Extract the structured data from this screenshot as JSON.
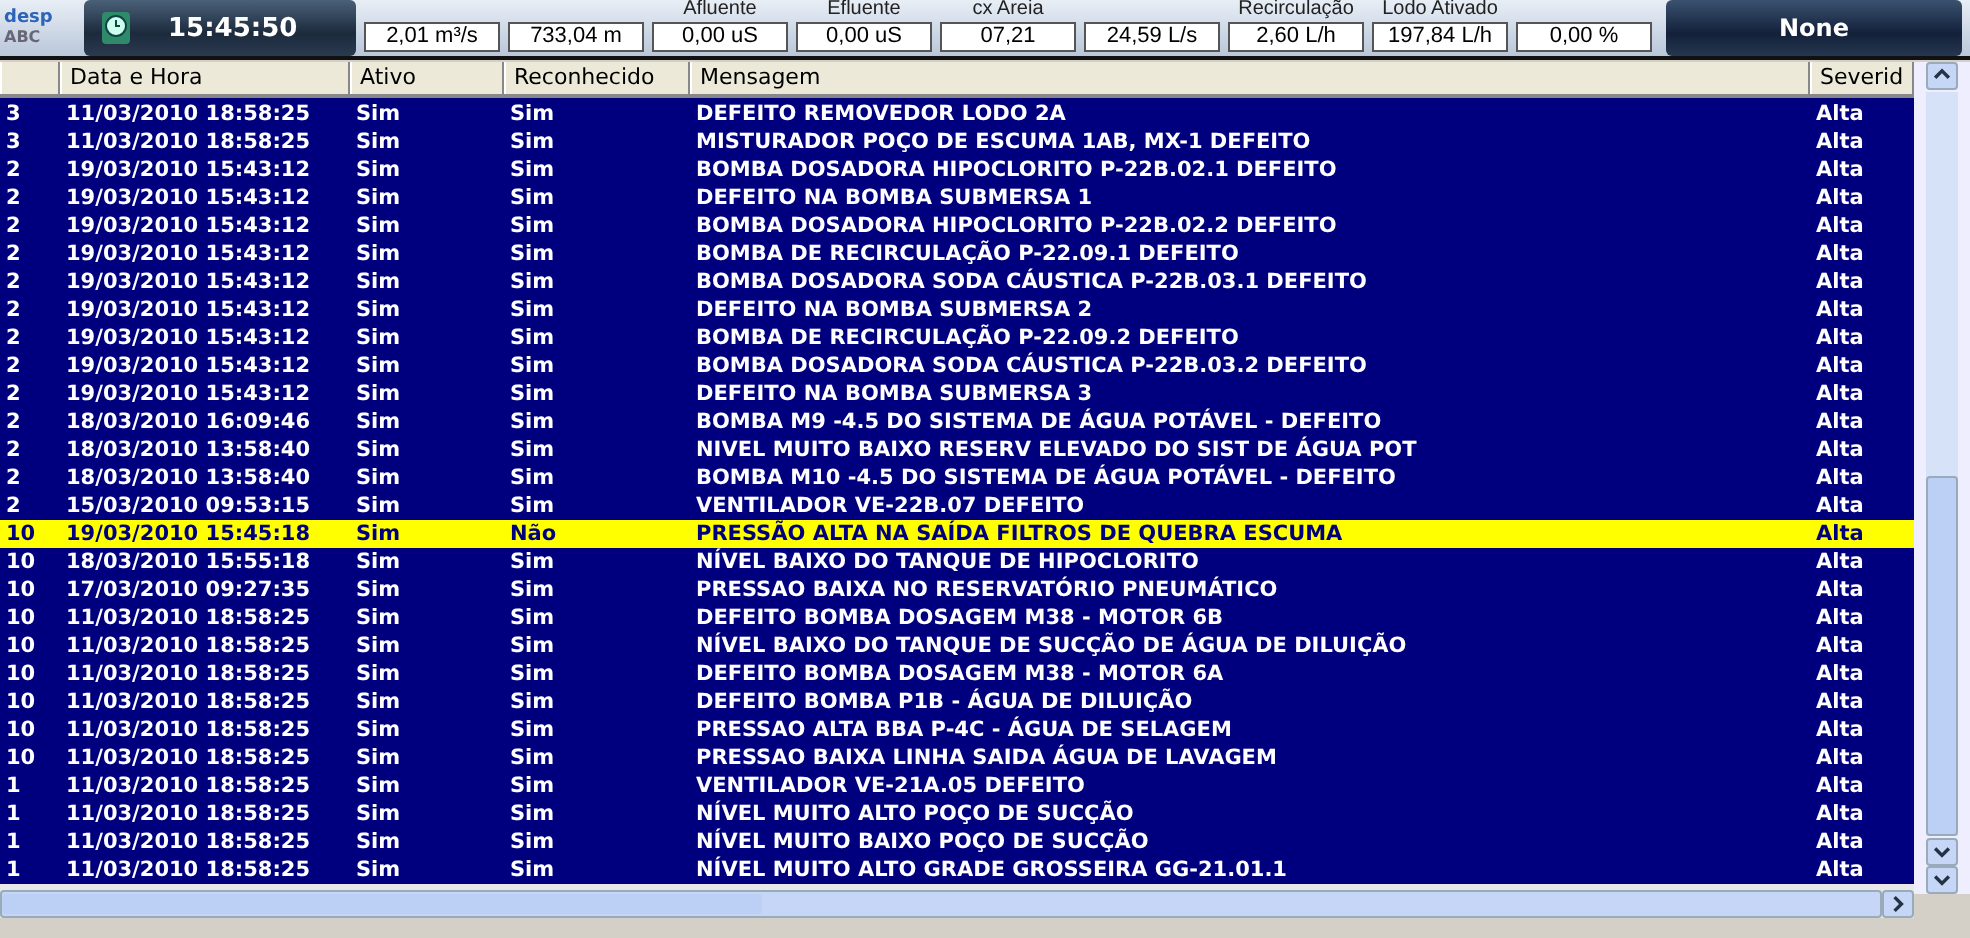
{
  "top_bar": {
    "logo": {
      "name": "desp",
      "subtitle": "ABC"
    },
    "clock": "15:45:50",
    "readouts": [
      {
        "value": "2,01 m³/s"
      },
      {
        "value": "733,04 m"
      },
      {
        "label": "Afluente",
        "value": "0,00 uS"
      },
      {
        "label": "Efluente",
        "value": "0,00 uS"
      },
      {
        "label": "cx Areia",
        "value": "07,21"
      },
      {
        "value": "24,59 L/s"
      },
      {
        "label": "Recirculação",
        "value": "2,60 L/h"
      },
      {
        "label": "Lodo Ativado",
        "value": "197,84 L/h"
      },
      {
        "value": "0,00 %"
      }
    ],
    "status": "None"
  },
  "table": {
    "columns": [
      "",
      "Data e Hora",
      "Ativo",
      "Reconhecido",
      "Mensagem",
      "Severid"
    ],
    "rows": [
      {
        "cells": [
          "3",
          "11/03/2010 18:58:25",
          "Sim",
          "Sim",
          "DEFEITO REMOVEDOR LODO 2A",
          "Alta"
        ],
        "selected": false
      },
      {
        "cells": [
          "3",
          "11/03/2010 18:58:25",
          "Sim",
          "Sim",
          "MISTURADOR POÇO DE ESCUMA 1AB, MX-1 DEFEITO",
          "Alta"
        ],
        "selected": false
      },
      {
        "cells": [
          "2",
          "19/03/2010 15:43:12",
          "Sim",
          "Sim",
          "BOMBA DOSADORA HIPOCLORITO P-22B.02.1 DEFEITO",
          "Alta"
        ],
        "selected": false
      },
      {
        "cells": [
          "2",
          "19/03/2010 15:43:12",
          "Sim",
          "Sim",
          "DEFEITO NA BOMBA SUBMERSA 1",
          "Alta"
        ],
        "selected": false
      },
      {
        "cells": [
          "2",
          "19/03/2010 15:43:12",
          "Sim",
          "Sim",
          "BOMBA DOSADORA HIPOCLORITO P-22B.02.2 DEFEITO",
          "Alta"
        ],
        "selected": false
      },
      {
        "cells": [
          "2",
          "19/03/2010 15:43:12",
          "Sim",
          "Sim",
          "BOMBA DE RECIRCULAÇÃO P-22.09.1 DEFEITO",
          "Alta"
        ],
        "selected": false
      },
      {
        "cells": [
          "2",
          "19/03/2010 15:43:12",
          "Sim",
          "Sim",
          "BOMBA DOSADORA SODA CÁUSTICA P-22B.03.1 DEFEITO",
          "Alta"
        ],
        "selected": false
      },
      {
        "cells": [
          "2",
          "19/03/2010 15:43:12",
          "Sim",
          "Sim",
          "DEFEITO NA BOMBA SUBMERSA 2",
          "Alta"
        ],
        "selected": false
      },
      {
        "cells": [
          "2",
          "19/03/2010 15:43:12",
          "Sim",
          "Sim",
          "BOMBA DE RECIRCULAÇÃO P-22.09.2 DEFEITO",
          "Alta"
        ],
        "selected": false
      },
      {
        "cells": [
          "2",
          "19/03/2010 15:43:12",
          "Sim",
          "Sim",
          "BOMBA DOSADORA SODA CÁUSTICA P-22B.03.2 DEFEITO",
          "Alta"
        ],
        "selected": false
      },
      {
        "cells": [
          "2",
          "19/03/2010 15:43:12",
          "Sim",
          "Sim",
          "DEFEITO NA BOMBA SUBMERSA 3",
          "Alta"
        ],
        "selected": false
      },
      {
        "cells": [
          "2",
          "18/03/2010 16:09:46",
          "Sim",
          "Sim",
          "BOMBA M9 -4.5 DO SISTEMA DE ÁGUA POTÁVEL - DEFEITO",
          "Alta"
        ],
        "selected": false
      },
      {
        "cells": [
          "2",
          "18/03/2010 13:58:40",
          "Sim",
          "Sim",
          "NIVEL MUITO BAIXO RESERV ELEVADO DO SIST DE ÁGUA POT",
          "Alta"
        ],
        "selected": false
      },
      {
        "cells": [
          "2",
          "18/03/2010 13:58:40",
          "Sim",
          "Sim",
          "BOMBA M10 -4.5 DO SISTEMA DE ÁGUA POTÁVEL - DEFEITO",
          "Alta"
        ],
        "selected": false
      },
      {
        "cells": [
          "2",
          "15/03/2010 09:53:15",
          "Sim",
          "Sim",
          "VENTILADOR VE-22B.07 DEFEITO",
          "Alta"
        ],
        "selected": false
      },
      {
        "cells": [
          "10",
          "19/03/2010 15:45:18",
          "Sim",
          "Não",
          "PRESSÃO ALTA NA SAÍDA FILTROS DE QUEBRA ESCUMA",
          "Alta"
        ],
        "selected": true
      },
      {
        "cells": [
          "10",
          "18/03/2010 15:55:18",
          "Sim",
          "Sim",
          "NÍVEL BAIXO DO TANQUE DE HIPOCLORITO",
          "Alta"
        ],
        "selected": false
      },
      {
        "cells": [
          "10",
          "17/03/2010 09:27:35",
          "Sim",
          "Sim",
          "PRESSAO BAIXA NO RESERVATÓRIO PNEUMÁTICO",
          "Alta"
        ],
        "selected": false
      },
      {
        "cells": [
          "10",
          "11/03/2010 18:58:25",
          "Sim",
          "Sim",
          "DEFEITO BOMBA DOSAGEM M38 - MOTOR 6B",
          "Alta"
        ],
        "selected": false
      },
      {
        "cells": [
          "10",
          "11/03/2010 18:58:25",
          "Sim",
          "Sim",
          "NÍVEL BAIXO DO TANQUE DE SUCÇÃO DE ÁGUA DE DILUIÇÃO",
          "Alta"
        ],
        "selected": false
      },
      {
        "cells": [
          "10",
          "11/03/2010 18:58:25",
          "Sim",
          "Sim",
          "DEFEITO BOMBA DOSAGEM M38 - MOTOR 6A",
          "Alta"
        ],
        "selected": false
      },
      {
        "cells": [
          "10",
          "11/03/2010 18:58:25",
          "Sim",
          "Sim",
          "DEFEITO BOMBA P1B - ÁGUA DE DILUIÇÃO",
          "Alta"
        ],
        "selected": false
      },
      {
        "cells": [
          "10",
          "11/03/2010 18:58:25",
          "Sim",
          "Sim",
          "PRESSAO ALTA BBA P-4C - ÁGUA DE SELAGEM",
          "Alta"
        ],
        "selected": false
      },
      {
        "cells": [
          "10",
          "11/03/2010 18:58:25",
          "Sim",
          "Sim",
          "PRESSAO BAIXA LINHA SAIDA ÁGUA DE LAVAGEM",
          "Alta"
        ],
        "selected": false
      },
      {
        "cells": [
          "1",
          "11/03/2010 18:58:25",
          "Sim",
          "Sim",
          "VENTILADOR VE-21A.05 DEFEITO",
          "Alta"
        ],
        "selected": false
      },
      {
        "cells": [
          "1",
          "11/03/2010 18:58:25",
          "Sim",
          "Sim",
          "NÍVEL MUITO ALTO POÇO DE SUCÇÃO",
          "Alta"
        ],
        "selected": false
      },
      {
        "cells": [
          "1",
          "11/03/2010 18:58:25",
          "Sim",
          "Sim",
          "NÍVEL MUITO BAIXO POÇO DE SUCÇÃO",
          "Alta"
        ],
        "selected": false
      },
      {
        "cells": [
          "1",
          "11/03/2010 18:58:25",
          "Sim",
          "Sim",
          "NÍVEL MUITO ALTO GRADE GROSSEIRA GG-21.01.1",
          "Alta"
        ],
        "selected": false
      }
    ]
  }
}
